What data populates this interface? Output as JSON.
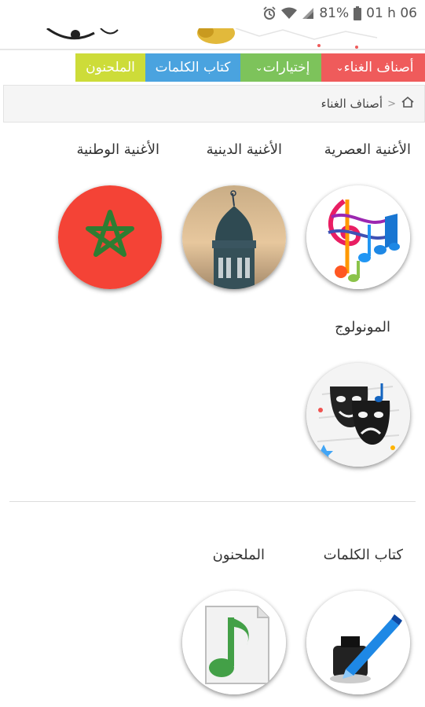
{
  "status_bar": {
    "battery": "81%",
    "time": "01 h 06"
  },
  "nav": {
    "items": [
      {
        "label": "أصناف الغناء"
      },
      {
        "label": "إختيارات"
      },
      {
        "label": "كتاب الكلمات"
      },
      {
        "label": "الملحنون"
      }
    ]
  },
  "breadcrumb": {
    "current": "أصناف الغناء",
    "separator": ">"
  },
  "categories": [
    {
      "label": "الأغنية العصرية",
      "icon": "music-notes-icon"
    },
    {
      "label": "الأغنية الدينية",
      "icon": "mosque-minaret-icon"
    },
    {
      "label": "الأغنية الوطنية",
      "icon": "morocco-flag-icon"
    },
    {
      "label": "المونولوج",
      "icon": "theater-masks-icon"
    }
  ],
  "people": [
    {
      "label": "كتاب الكلمات",
      "icon": "ink-pen-icon"
    },
    {
      "label": "الملحنون",
      "icon": "music-sheet-icon"
    }
  ],
  "colors": {
    "nav_red": "#ef5b5b",
    "nav_green": "#7dc35b",
    "nav_blue": "#4aa3df",
    "nav_lime": "#cddc39",
    "flag_red": "#f44336",
    "flag_green": "#2e7d32"
  }
}
